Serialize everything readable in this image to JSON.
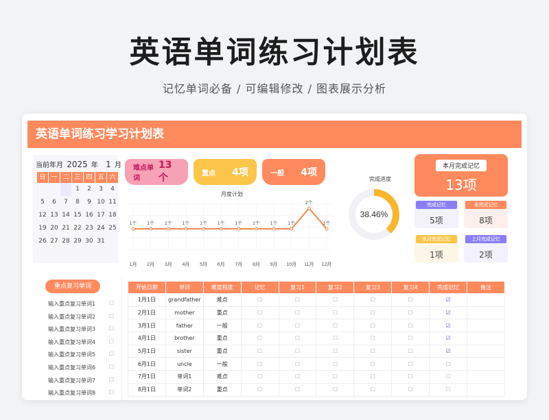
{
  "hero": {
    "title": "英语单词练习计划表",
    "subtitle": "记忆单词必备 / 可编辑修改 / 图表展示分析"
  },
  "sheet": {
    "banner": "英语单词练习学习计划表",
    "calendar": {
      "label_prefix": "当前年月",
      "year": "2025",
      "year_unit": "年",
      "month": "1",
      "month_unit": "月",
      "weekdays": [
        "日",
        "一",
        "二",
        "三",
        "四",
        "五",
        "六"
      ],
      "days": [
        "",
        "",
        "",
        "1",
        "2",
        "3",
        "4",
        "5",
        "6",
        "7",
        "8",
        "9",
        "10",
        "11",
        "12",
        "13",
        "14",
        "15",
        "16",
        "17",
        "18",
        "19",
        "20",
        "21",
        "22",
        "23",
        "24",
        "25",
        "26",
        "27",
        "28",
        "29",
        "30",
        "31"
      ]
    },
    "kpis": [
      {
        "label": "难点单词",
        "value": "13个"
      },
      {
        "label": "重点",
        "value": "4项"
      },
      {
        "label": "一般",
        "value": "4项"
      }
    ],
    "progress": {
      "label": "完成进度",
      "value_text": "38.46%",
      "fraction": 0.3846
    },
    "month_summary": {
      "label": "本月完成记忆",
      "value": "13项"
    },
    "stats": [
      {
        "label": "完成记忆",
        "value": "5项",
        "color": "#8b7ef5"
      },
      {
        "label": "未完成记忆",
        "value": "8项",
        "color": "#ff8a5e"
      },
      {
        "label": "本月完成记忆",
        "value": "1项",
        "color": "#fbc54a"
      },
      {
        "label": "上月完成记忆",
        "value": "2项",
        "color": "#8b7ef5"
      }
    ],
    "key_list": {
      "tag": "重点复习单词",
      "items": [
        "输入重点复习单词1",
        "输入重点复习单词2",
        "输入重点复习单词3",
        "输入重点复习单词4",
        "输入重点复习单词5",
        "输入重点复习单词6",
        "输入重点复习单词7",
        "输入重点复习单词8"
      ]
    },
    "table": {
      "headers": [
        "开始日期",
        "单词",
        "难度程度",
        "记忆",
        "复习1",
        "复习2",
        "复习3",
        "复习4",
        "完成记忆",
        "备注"
      ],
      "rows": [
        {
          "date": "1月1日",
          "word": "grandfather",
          "level": "难点",
          "done": "☑"
        },
        {
          "date": "2月1日",
          "word": "mother",
          "level": "重点",
          "done": "☑"
        },
        {
          "date": "3月1日",
          "word": "father",
          "level": "一般",
          "done": "☑"
        },
        {
          "date": "4月1日",
          "word": "brother",
          "level": "重点",
          "done": "☑"
        },
        {
          "date": "5月1日",
          "word": "sister",
          "level": "重点",
          "done": "☑"
        },
        {
          "date": "6月1日",
          "word": "uncle",
          "level": "一般",
          "done": "☐"
        },
        {
          "date": "7月1日",
          "word": "单词1",
          "level": "难点",
          "done": "☐"
        },
        {
          "date": "8月1日",
          "word": "单词2",
          "level": "重点",
          "done": "☐"
        }
      ],
      "empty_box": "☐"
    }
  },
  "chart_data": {
    "type": "line",
    "title": "月度计划",
    "categories": [
      "1月",
      "2月",
      "3月",
      "4月",
      "5月",
      "6月",
      "7月",
      "8月",
      "9月",
      "10月",
      "11月",
      "12月"
    ],
    "values": [
      1,
      1,
      1,
      1,
      1,
      1,
      1,
      1,
      1,
      1,
      2,
      1
    ],
    "data_labels": [
      "1个",
      "1个",
      "1个",
      "1个",
      "1个",
      "1个",
      "1个",
      "1个",
      "1个",
      "1个",
      "2个",
      "1个"
    ],
    "ylim": [
      0,
      2.2
    ],
    "color": "#f08a4b"
  }
}
